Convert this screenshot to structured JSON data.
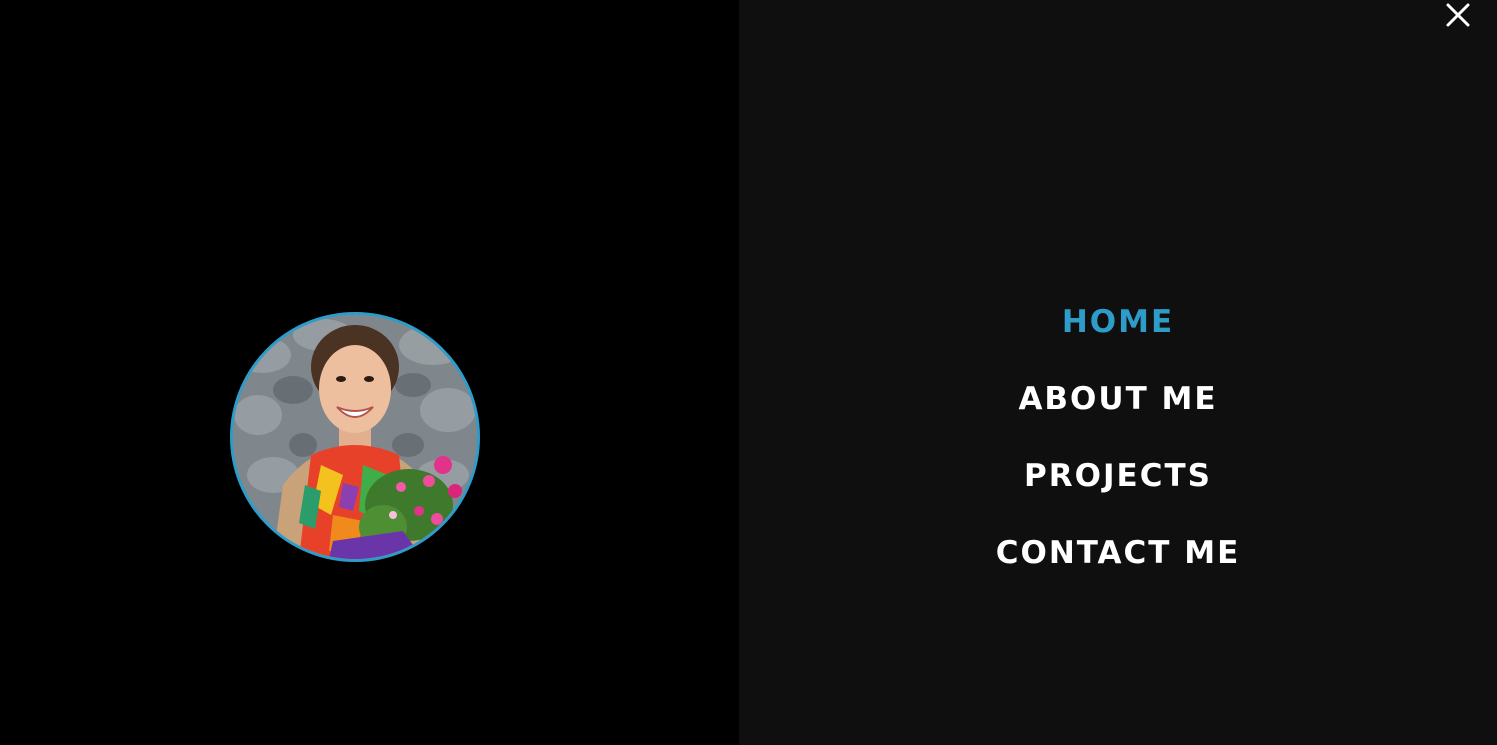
{
  "colors": {
    "accent": "#2e9cc9",
    "left_background": "#000000",
    "menu_background": "#0f0f0f",
    "menu_text": "#ffffff"
  },
  "menu": {
    "close_icon": "close-icon",
    "items": [
      {
        "label": "HOME",
        "active": true
      },
      {
        "label": "ABOUT ME",
        "active": false
      },
      {
        "label": "PROJECTS",
        "active": false
      },
      {
        "label": "CONTACT ME",
        "active": false
      }
    ]
  },
  "profile": {
    "image": "profile-photo"
  }
}
